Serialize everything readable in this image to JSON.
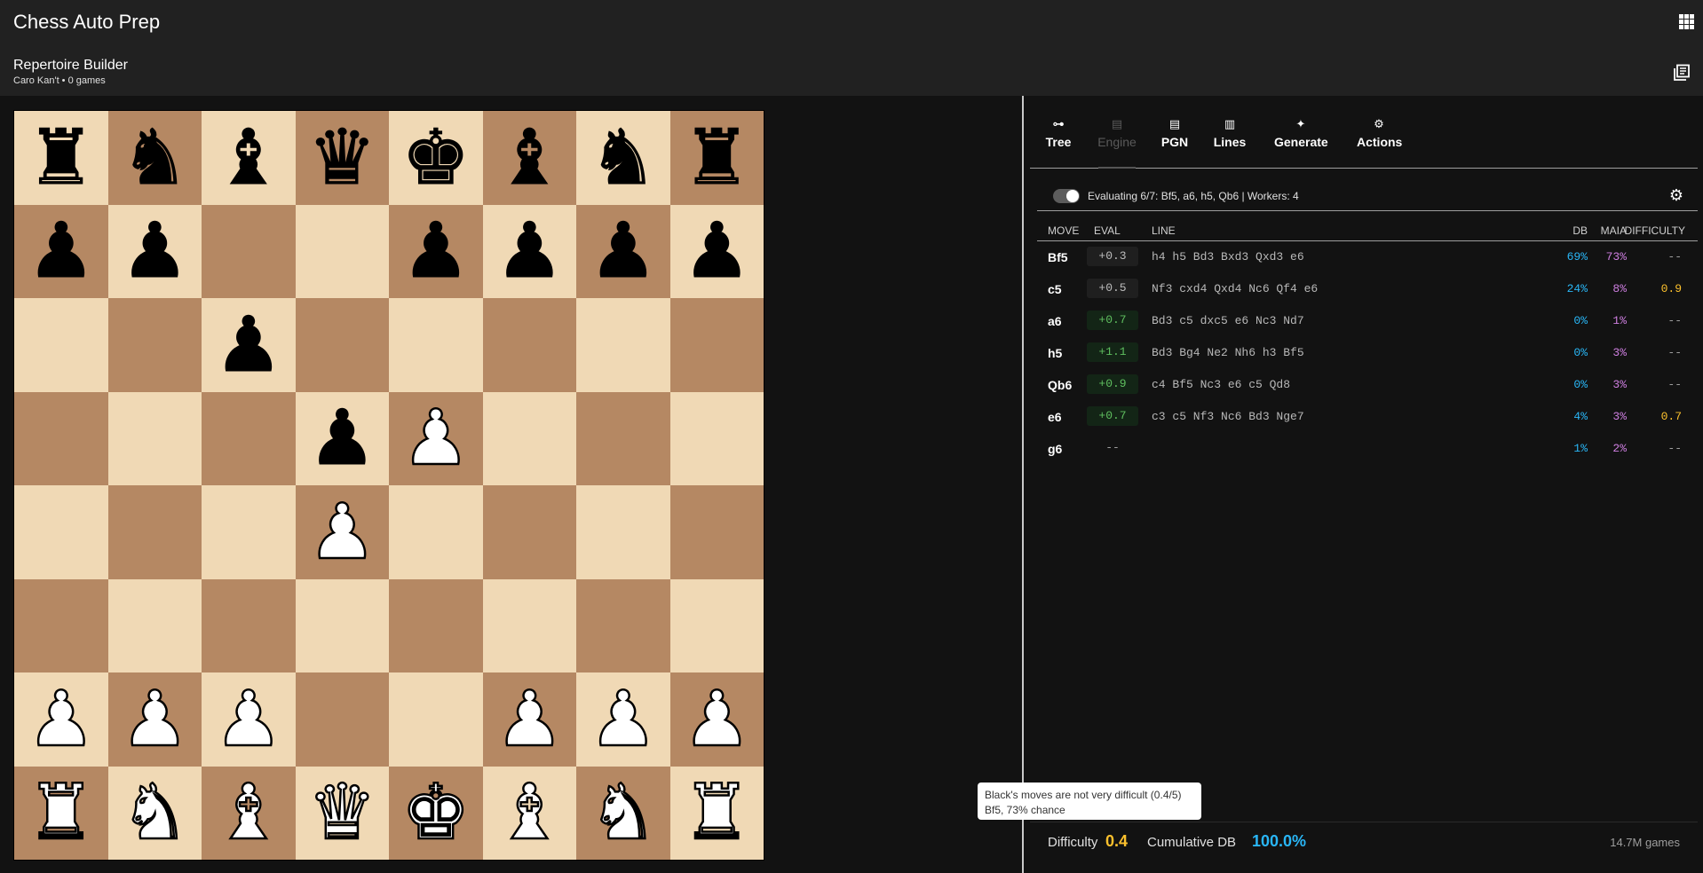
{
  "app": {
    "title": "Chess Auto Prep"
  },
  "subheader": {
    "title": "Repertoire Builder",
    "meta": "Caro Kan't • 0 games"
  },
  "board": {
    "light_color": "#f0d9b5",
    "dark_color": "#b58863",
    "ranks": [
      [
        "bR",
        "bN",
        "bB",
        "bQ",
        "bK",
        "bB",
        "bN",
        "bR"
      ],
      [
        "bP",
        "bP",
        "",
        "",
        "bP",
        "bP",
        "bP",
        "bP"
      ],
      [
        "",
        "",
        "bP",
        "",
        "",
        "",
        "",
        ""
      ],
      [
        "",
        "",
        "",
        "bP",
        "wP",
        "",
        "",
        ""
      ],
      [
        "",
        "",
        "",
        "wP",
        "",
        "",
        "",
        ""
      ],
      [
        "",
        "",
        "",
        "",
        "",
        "",
        "",
        ""
      ],
      [
        "wP",
        "wP",
        "wP",
        "",
        "",
        "wP",
        "wP",
        "wP"
      ],
      [
        "wR",
        "wN",
        "wB",
        "wQ",
        "wK",
        "wB",
        "wN",
        "wR"
      ]
    ]
  },
  "tabs": [
    {
      "id": "tree",
      "label": "Tree",
      "icon": "tree-icon"
    },
    {
      "id": "engine",
      "label": "Engine",
      "icon": "engine-icon",
      "disabled": true
    },
    {
      "id": "pgn",
      "label": "PGN",
      "icon": "document-icon"
    },
    {
      "id": "lines",
      "label": "Lines",
      "icon": "library-icon"
    },
    {
      "id": "generate",
      "label": "Generate",
      "icon": "sparkle-icon"
    },
    {
      "id": "actions",
      "label": "Actions",
      "icon": "gear-icon"
    }
  ],
  "engine": {
    "toggle_on": true,
    "status": "Evaluating 6/7: Bf5, a6, h5, Qb6  |  Workers: 4"
  },
  "table": {
    "headers": {
      "move": "MOVE",
      "eval": "EVAL",
      "line": "LINE",
      "db": "DB",
      "maia": "MAIA",
      "difficulty": "DIFFICULTY"
    },
    "rows": [
      {
        "move": "Bf5",
        "eval": "+0.3",
        "line": "h4 h5 Bd3 Bxd3 Qxd3 e6",
        "db": "69%",
        "maia": "73%",
        "difficulty": "--"
      },
      {
        "move": "c5",
        "eval": "+0.5",
        "line": "Nf3 cxd4 Qxd4 Nc6 Qf4 e6",
        "db": "24%",
        "maia": "8%",
        "difficulty": "0.9"
      },
      {
        "move": "a6",
        "eval": "+0.7",
        "line": "Bd3 c5 dxc5 e6 Nc3 Nd7",
        "db": "0%",
        "maia": "1%",
        "difficulty": "--"
      },
      {
        "move": "h5",
        "eval": "+1.1",
        "line": "Bd3 Bg4 Ne2 Nh6 h3 Bf5",
        "db": "0%",
        "maia": "3%",
        "difficulty": "--"
      },
      {
        "move": "Qb6",
        "eval": "+0.9",
        "line": "c4 Bf5 Nc3 e6 c5 Qd8",
        "db": "0%",
        "maia": "3%",
        "difficulty": "--"
      },
      {
        "move": "e6",
        "eval": "+0.7",
        "line": "c3 c5 Nf3 Nc6 Bd3 Nge7",
        "db": "4%",
        "maia": "3%",
        "difficulty": "0.7"
      },
      {
        "move": "g6",
        "eval": "--",
        "line": "",
        "db": "1%",
        "maia": "2%",
        "difficulty": "--"
      }
    ]
  },
  "tooltip": {
    "line1": "Black's moves are not very difficult (0.4/5)",
    "line2": "Bf5, 73% chance"
  },
  "footer": {
    "difficulty_label": "Difficulty",
    "difficulty_value": "0.4",
    "cumulative_label": "Cumulative DB",
    "cumulative_value": "100.0%",
    "games": "14.7M games"
  },
  "colors": {
    "accent_blue": "#29b6f6",
    "accent_yellow": "#fbc02d",
    "maia_purple": "#ce7fe0",
    "eval_green": "#5fbf5f"
  }
}
